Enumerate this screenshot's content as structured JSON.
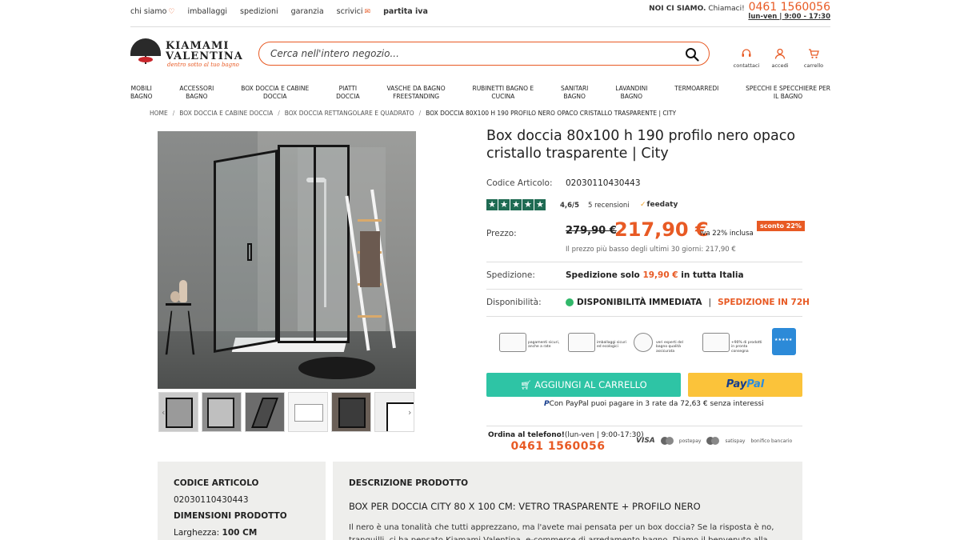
{
  "topbar": {
    "links": [
      {
        "label": "chi siamo"
      },
      {
        "label": "imballaggi"
      },
      {
        "label": "spedizioni"
      },
      {
        "label": "garanzia"
      },
      {
        "label": "scrivici"
      },
      {
        "label": "partita iva"
      }
    ],
    "noi_ci_siamo": "NOI CI SIAMO.",
    "chiamaci": "Chiamaci!",
    "phone": "0461 1560056",
    "hours": "lun-ven | 9:00 - 17:30"
  },
  "logo": {
    "line1": "KIAMAMI",
    "line2": "VALENTINA",
    "tagline": "dentro sotto al tuo bagno"
  },
  "search": {
    "placeholder": "Cerca nell'intero negozio..."
  },
  "header_icons": [
    {
      "label": "contattaci",
      "icon": "headset-icon"
    },
    {
      "label": "accedi",
      "icon": "user-icon"
    },
    {
      "label": "carrello",
      "icon": "cart-icon"
    }
  ],
  "nav": [
    {
      "line1": "MOBILI",
      "line2": "BAGNO"
    },
    {
      "line1": "ACCESSORI",
      "line2": "BAGNO"
    },
    {
      "line1": "BOX DOCCIA E CABINE",
      "line2": "DOCCIA"
    },
    {
      "line1": "PIATTI",
      "line2": "DOCCIA"
    },
    {
      "line1": "VASCHE DA BAGNO",
      "line2": "FREESTANDING"
    },
    {
      "line1": "RUBINETTI BAGNO E",
      "line2": "CUCINA"
    },
    {
      "line1": "SANITARI",
      "line2": "BAGNO"
    },
    {
      "line1": "LAVANDINI",
      "line2": "BAGNO"
    },
    {
      "line1": "TERMOARREDI",
      "line2": ""
    },
    {
      "line1": "SPECCHI E SPECCHIERE PER",
      "line2": "IL BAGNO"
    }
  ],
  "breadcrumb": [
    "HOME",
    "BOX DOCCIA E CABINE DOCCIA",
    "BOX DOCCIA RETTANGOLARE E QUADRATO",
    "BOX DOCCIA 80X100 H 190 PROFILO NERO OPACO CRISTALLO TRASPARENTE | CITY"
  ],
  "product": {
    "title": "Box doccia 80x100 h 190 profilo nero opaco cristallo trasparente | City",
    "code_label": "Codice Articolo:",
    "code": "02030110430443",
    "rating_value": "4,6/5",
    "rating_stars": 5,
    "reviews": "5 recensioni",
    "feedaty": "feedaty",
    "price_label": "Prezzo:",
    "old_price": "279,90 €",
    "new_price": "217,90 €",
    "vat": "iva 22% inclusa",
    "discount": "sconto 22%",
    "lowest_price": "Il prezzo più basso degli ultimi 30 giorni: 217,90 €",
    "shipping_label": "Spedizione:",
    "shipping_pre": "Spedizione solo",
    "shipping_price": "19,90 €",
    "shipping_post": "in tutta Italia",
    "availability_label": "Disponibilità:",
    "availability": "DISPONIBILITÀ IMMEDIATA",
    "availability_sep": "|",
    "shipping_72": "SPEDIZIONE IN 72H"
  },
  "badges": [
    {
      "text": "pagamenti sicuri, anche a rate"
    },
    {
      "text": "imballaggi sicuri ed ecologici"
    },
    {
      "text": "veri esperti del bagno qualità assicurata"
    },
    {
      "text": "+90% di prodotti in pronta consegna"
    }
  ],
  "actions": {
    "add_to_cart": "AGGIUNGI AL CARRELLO",
    "paypal_1": "Pay",
    "paypal_2": "Pal",
    "paypal_installments": "Con PayPal puoi pagare in 3 rate da 72,63 € senza interessi"
  },
  "order_phone": {
    "label_bold": "Ordina al telefono!",
    "label_rest": "(lun-ven | 9:00-17:30)",
    "phone": "0461 1560056"
  },
  "payment_icons": [
    "VISA",
    "postepay",
    "satispay",
    "bonifico bancario"
  ],
  "details": {
    "code_heading": "CODICE ARTICOLO",
    "code_value": "02030110430443",
    "dimensions_heading": "DIMENSIONI PRODOTTO",
    "width_label": "Larghezza:",
    "width_value": "100 CM",
    "description_heading": "DESCRIZIONE PRODOTTO",
    "description_subtitle": "BOX PER DOCCIA CITY 80 X 100 CM: VETRO TRASPARENTE + PROFILO NERO",
    "description_text": "Il nero è una tonalità che tutti apprezzano, ma l'avete mai pensata per un box doccia? Se la risposta è no, tranquilli, ci ha pensato Kiamami Valentina, e-commerce di arredamento bagno. Diamo il benvenuto alla serie City, una linea di"
  },
  "colors": {
    "accent": "#e85a24",
    "cart_button": "#2ec4a5",
    "paypal_button": "#fbc33a",
    "available": "#31b86a",
    "stars": "#1f6b53"
  }
}
